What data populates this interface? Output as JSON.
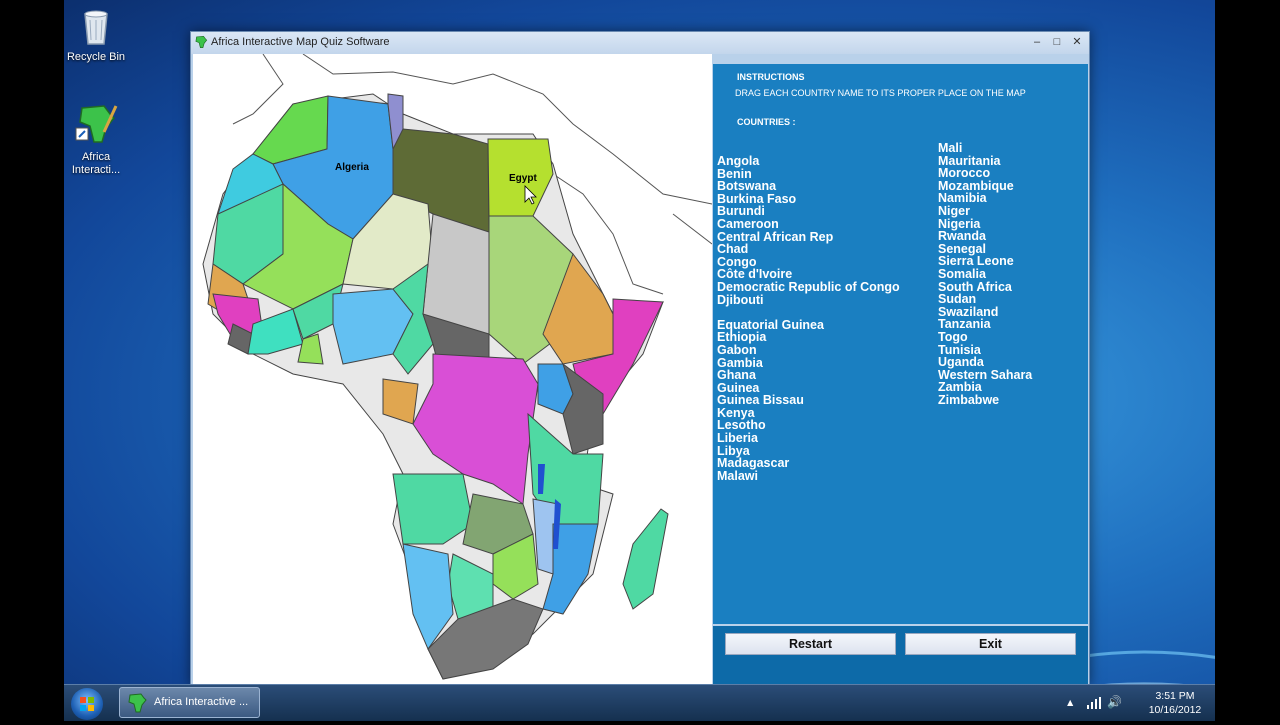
{
  "desktop": {
    "icons": [
      {
        "label": "Recycle Bin"
      },
      {
        "label": "Africa Interacti..."
      }
    ]
  },
  "window": {
    "title": "Africa Interactive Map Quiz Software",
    "controls": {
      "minimize": "–",
      "maximize": "□",
      "close": "✕"
    }
  },
  "map": {
    "labels": {
      "algeria": "Algeria",
      "egypt": "Egypt"
    }
  },
  "instructions": {
    "heading": "INSTRUCTIONS",
    "text": "DRAG EACH COUNTRY NAME TO ITS PROPER PLACE ON THE MAP",
    "countries_heading": "COUNTRIES :"
  },
  "countries_left": [
    "Angola",
    "Benin",
    "Botswana",
    "Burkina Faso",
    "Burundi",
    "Cameroon",
    "Central African Rep",
    "Chad",
    "Congo",
    "Côte d'Ivoire",
    "Democratic Republic of Congo",
    "Djibouti",
    "",
    "Equatorial Guinea",
    "Ethiopia",
    "Gabon",
    "Gambia",
    "Ghana",
    "Guinea",
    "Guinea Bissau",
    "Kenya",
    "Lesotho",
    "Liberia",
    "Libya",
    "Madagascar",
    "Malawi"
  ],
  "countries_right": [
    "Mali",
    "Mauritania",
    "Morocco",
    "Mozambique",
    "Namibia",
    "Niger",
    "Nigeria",
    "Rwanda",
    "Senegal",
    "Sierra Leone",
    "Somalia",
    "South Africa",
    "Sudan",
    "Swaziland",
    "Tanzania",
    "Togo",
    "Tunisia",
    "Uganda",
    "Western Sahara",
    "Zambia",
    "Zimbabwe"
  ],
  "buttons": {
    "restart": "Restart",
    "exit": "Exit"
  },
  "taskbar": {
    "task_label": "Africa Interactive ...",
    "time": "3:51 PM",
    "date": "10/16/2012"
  },
  "colors": {
    "panel": "#1a7fc1",
    "bottom_panel": "#0d6aa8"
  }
}
